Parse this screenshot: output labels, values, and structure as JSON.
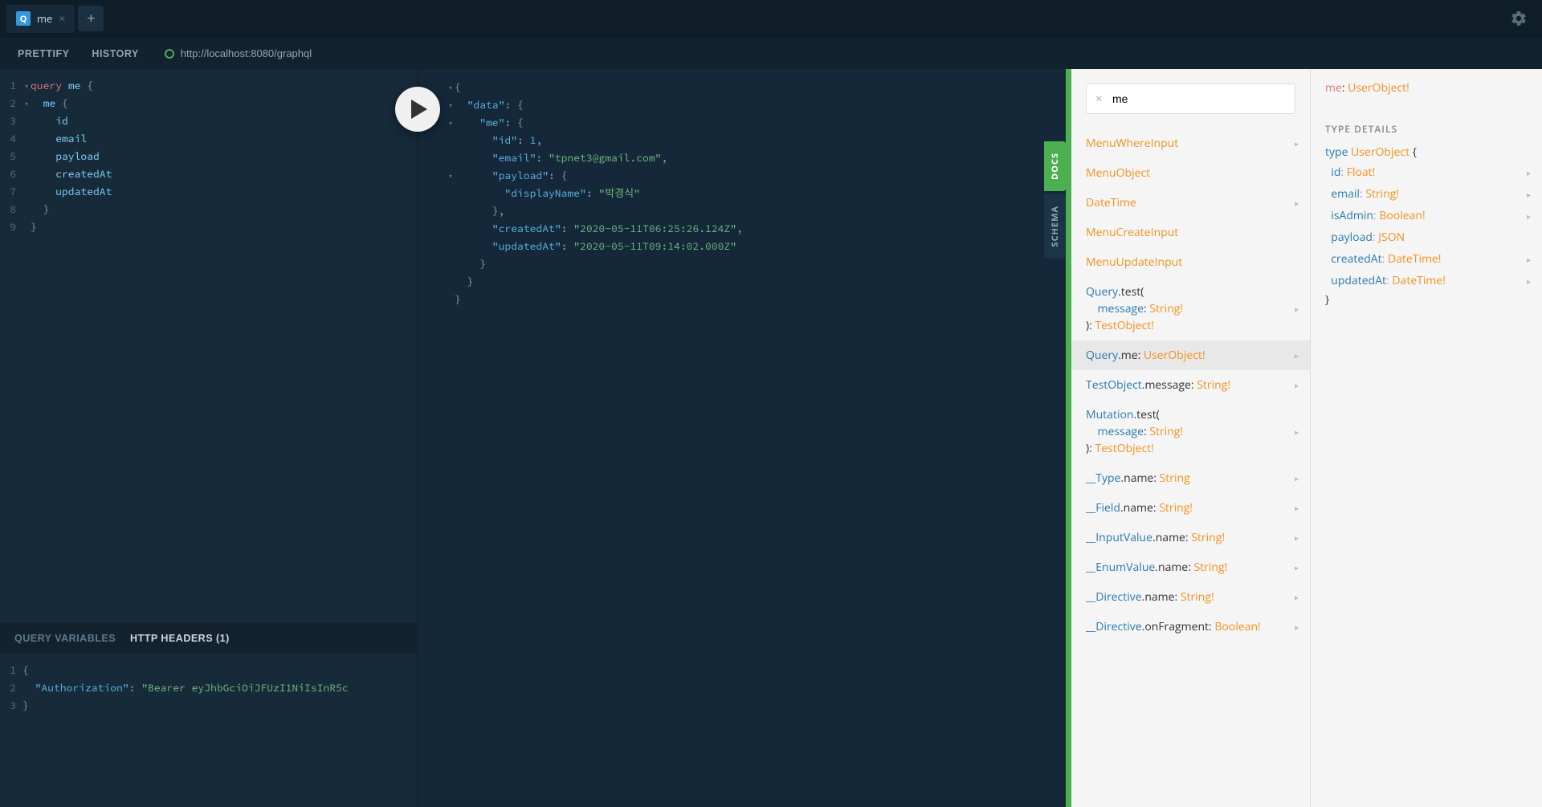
{
  "tabs": {
    "items": [
      {
        "icon": "Q",
        "name": "me"
      }
    ]
  },
  "toolbar": {
    "prettify": "PRETTIFY",
    "history": "HISTORY",
    "endpoint": "http://localhost:8080/graphql"
  },
  "side": {
    "docs": "DOCS",
    "schema": "SCHEMA"
  },
  "query": {
    "lines": [
      {
        "n": 1,
        "fold": true,
        "content": [
          [
            "kw",
            "query"
          ],
          [
            "sp",
            " "
          ],
          [
            "def",
            "me"
          ],
          [
            "pl",
            " {"
          ]
        ]
      },
      {
        "n": 2,
        "fold": true,
        "indent": 1,
        "content": [
          [
            "attr",
            "me"
          ],
          [
            "pl",
            " {"
          ]
        ]
      },
      {
        "n": 3,
        "indent": 2,
        "content": [
          [
            "attr",
            "id"
          ]
        ]
      },
      {
        "n": 4,
        "indent": 2,
        "content": [
          [
            "attr",
            "email"
          ]
        ]
      },
      {
        "n": 5,
        "indent": 2,
        "content": [
          [
            "attr",
            "payload"
          ]
        ]
      },
      {
        "n": 6,
        "indent": 2,
        "content": [
          [
            "attr",
            "createdAt"
          ]
        ]
      },
      {
        "n": 7,
        "indent": 2,
        "content": [
          [
            "attr",
            "updatedAt"
          ]
        ]
      },
      {
        "n": 8,
        "indent": 1,
        "content": [
          [
            "pl",
            "}"
          ]
        ]
      },
      {
        "n": 9,
        "content": [
          [
            "pl",
            "}"
          ]
        ]
      }
    ]
  },
  "result": {
    "lines": [
      {
        "fold": true,
        "indent": 0,
        "content": [
          [
            "pl",
            "{"
          ]
        ]
      },
      {
        "fold": true,
        "indent": 1,
        "content": [
          [
            "prop",
            "\"data\""
          ],
          [
            "pl",
            ": {"
          ]
        ]
      },
      {
        "fold": true,
        "indent": 2,
        "content": [
          [
            "prop",
            "\"me\""
          ],
          [
            "pl",
            ": {"
          ]
        ]
      },
      {
        "indent": 3,
        "content": [
          [
            "prop",
            "\"id\""
          ],
          [
            "pl",
            ": "
          ],
          [
            "num",
            "1"
          ],
          [
            "pl",
            ","
          ]
        ]
      },
      {
        "indent": 3,
        "content": [
          [
            "prop",
            "\"email\""
          ],
          [
            "pl",
            ": "
          ],
          [
            "str",
            "\"tpnet3@gmail.com\""
          ],
          [
            "pl",
            ","
          ]
        ]
      },
      {
        "fold": true,
        "indent": 3,
        "content": [
          [
            "prop",
            "\"payload\""
          ],
          [
            "pl",
            ": {"
          ]
        ]
      },
      {
        "indent": 4,
        "content": [
          [
            "prop",
            "\"displayName\""
          ],
          [
            "pl",
            ": "
          ],
          [
            "str",
            "\"박경식\""
          ]
        ]
      },
      {
        "indent": 3,
        "content": [
          [
            "pl",
            "},"
          ]
        ]
      },
      {
        "indent": 3,
        "content": [
          [
            "prop",
            "\"createdAt\""
          ],
          [
            "pl",
            ": "
          ],
          [
            "str",
            "\"2020-05-11T06:25:26.124Z\""
          ],
          [
            "pl",
            ","
          ]
        ]
      },
      {
        "indent": 3,
        "content": [
          [
            "prop",
            "\"updatedAt\""
          ],
          [
            "pl",
            ": "
          ],
          [
            "str",
            "\"2020-05-11T09:14:02.000Z\""
          ]
        ]
      },
      {
        "indent": 2,
        "content": [
          [
            "pl",
            "}"
          ]
        ]
      },
      {
        "indent": 1,
        "content": [
          [
            "pl",
            "}"
          ]
        ]
      },
      {
        "indent": 0,
        "content": [
          [
            "pl",
            "}"
          ]
        ]
      }
    ]
  },
  "bottom": {
    "variables": "QUERY VARIABLES",
    "headers": "HTTP HEADERS (1)",
    "lines": [
      {
        "n": 1,
        "content": [
          [
            "pl",
            "{"
          ]
        ]
      },
      {
        "n": 2,
        "indent": 1,
        "content": [
          [
            "prop",
            "\"Authorization\""
          ],
          [
            "pl",
            ": "
          ],
          [
            "str",
            "\"Bearer eyJhbGciOiJFUzI1NiIsInR5c"
          ]
        ]
      },
      {
        "n": 3,
        "content": [
          [
            "pl",
            "}"
          ]
        ]
      }
    ]
  },
  "docs": {
    "search": "me",
    "items": [
      {
        "tokens": [
          [
            "tn",
            "MenuWhereInput"
          ]
        ],
        "arrow": true
      },
      {
        "tokens": [
          [
            "tn",
            "MenuObject"
          ]
        ]
      },
      {
        "tokens": [
          [
            "tn",
            "DateTime"
          ]
        ],
        "arrow": true
      },
      {
        "tokens": [
          [
            "tn",
            "MenuCreateInput"
          ]
        ]
      },
      {
        "tokens": [
          [
            "tn",
            "MenuUpdateInput"
          ]
        ]
      },
      {
        "tokens": [
          [
            "fn",
            "Query"
          ],
          [
            "pl",
            "."
          ],
          [
            "pl",
            "test("
          ],
          [
            "br",
            ""
          ],
          [
            "ind",
            ""
          ],
          [
            "fn",
            "message"
          ],
          [
            "pl",
            ": "
          ],
          [
            "tn",
            "String!"
          ],
          [
            "br",
            ""
          ],
          [
            "pl",
            "): "
          ],
          [
            "tn",
            "TestObject!"
          ]
        ],
        "arrow": true
      },
      {
        "tokens": [
          [
            "fn",
            "Query"
          ],
          [
            "pl",
            "."
          ],
          [
            "pl",
            "me: "
          ],
          [
            "tn",
            "UserObject!"
          ]
        ],
        "arrow": true,
        "active": true
      },
      {
        "tokens": [
          [
            "fn",
            "TestObject"
          ],
          [
            "pl",
            "."
          ],
          [
            "pl",
            "message: "
          ],
          [
            "tn",
            "String!"
          ]
        ],
        "arrow": true
      },
      {
        "tokens": [
          [
            "fn",
            "Mutation"
          ],
          [
            "pl",
            "."
          ],
          [
            "pl",
            "test("
          ],
          [
            "br",
            ""
          ],
          [
            "ind",
            ""
          ],
          [
            "fn",
            "message"
          ],
          [
            "pl",
            ": "
          ],
          [
            "tn",
            "String!"
          ],
          [
            "br",
            ""
          ],
          [
            "pl",
            "): "
          ],
          [
            "tn",
            "TestObject!"
          ]
        ],
        "arrow": true
      },
      {
        "tokens": [
          [
            "fn",
            "__Type"
          ],
          [
            "pl",
            "."
          ],
          [
            "pl",
            "name: "
          ],
          [
            "tn",
            "String"
          ]
        ],
        "arrow": true
      },
      {
        "tokens": [
          [
            "fn",
            "__Field"
          ],
          [
            "pl",
            "."
          ],
          [
            "pl",
            "name: "
          ],
          [
            "tn",
            "String!"
          ]
        ],
        "arrow": true
      },
      {
        "tokens": [
          [
            "fn",
            "__InputValue"
          ],
          [
            "pl",
            "."
          ],
          [
            "pl",
            "name: "
          ],
          [
            "tn",
            "String!"
          ]
        ],
        "arrow": true
      },
      {
        "tokens": [
          [
            "fn",
            "__EnumValue"
          ],
          [
            "pl",
            "."
          ],
          [
            "pl",
            "name: "
          ],
          [
            "tn",
            "String!"
          ]
        ],
        "arrow": true
      },
      {
        "tokens": [
          [
            "fn",
            "__Directive"
          ],
          [
            "pl",
            "."
          ],
          [
            "pl",
            "name: "
          ],
          [
            "tn",
            "String!"
          ]
        ],
        "arrow": true
      },
      {
        "tokens": [
          [
            "fn",
            "__Directive"
          ],
          [
            "pl",
            "."
          ],
          [
            "pl",
            "onFragment: "
          ],
          [
            "tn",
            "Boolean!"
          ]
        ],
        "arrow": true
      }
    ],
    "details": {
      "header": {
        "field": "me",
        "type": "UserObject!"
      },
      "sectionTitle": "TYPE DETAILS",
      "typeKeyword": "type",
      "typeName": "UserObject",
      "fields": [
        {
          "name": "id",
          "type": "Float!",
          "arrow": true
        },
        {
          "name": "email",
          "type": "String!",
          "arrow": true
        },
        {
          "name": "isAdmin",
          "type": "Boolean!",
          "arrow": true
        },
        {
          "name": "payload",
          "type": "JSON"
        },
        {
          "name": "createdAt",
          "type": "DateTime!",
          "arrow": true
        },
        {
          "name": "updatedAt",
          "type": "DateTime!",
          "arrow": true
        }
      ]
    }
  }
}
